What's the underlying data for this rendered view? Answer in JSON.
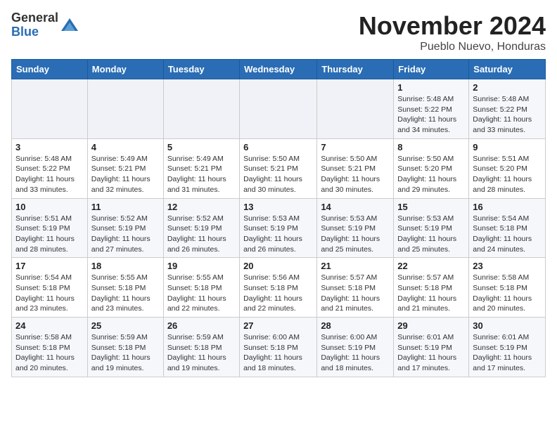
{
  "header": {
    "logo_line1": "General",
    "logo_line2": "Blue",
    "month_year": "November 2024",
    "location": "Pueblo Nuevo, Honduras"
  },
  "days_of_week": [
    "Sunday",
    "Monday",
    "Tuesday",
    "Wednesday",
    "Thursday",
    "Friday",
    "Saturday"
  ],
  "weeks": [
    [
      {
        "day": "",
        "info": ""
      },
      {
        "day": "",
        "info": ""
      },
      {
        "day": "",
        "info": ""
      },
      {
        "day": "",
        "info": ""
      },
      {
        "day": "",
        "info": ""
      },
      {
        "day": "1",
        "info": "Sunrise: 5:48 AM\nSunset: 5:22 PM\nDaylight: 11 hours and 34 minutes."
      },
      {
        "day": "2",
        "info": "Sunrise: 5:48 AM\nSunset: 5:22 PM\nDaylight: 11 hours and 33 minutes."
      }
    ],
    [
      {
        "day": "3",
        "info": "Sunrise: 5:48 AM\nSunset: 5:22 PM\nDaylight: 11 hours and 33 minutes."
      },
      {
        "day": "4",
        "info": "Sunrise: 5:49 AM\nSunset: 5:21 PM\nDaylight: 11 hours and 32 minutes."
      },
      {
        "day": "5",
        "info": "Sunrise: 5:49 AM\nSunset: 5:21 PM\nDaylight: 11 hours and 31 minutes."
      },
      {
        "day": "6",
        "info": "Sunrise: 5:50 AM\nSunset: 5:21 PM\nDaylight: 11 hours and 30 minutes."
      },
      {
        "day": "7",
        "info": "Sunrise: 5:50 AM\nSunset: 5:21 PM\nDaylight: 11 hours and 30 minutes."
      },
      {
        "day": "8",
        "info": "Sunrise: 5:50 AM\nSunset: 5:20 PM\nDaylight: 11 hours and 29 minutes."
      },
      {
        "day": "9",
        "info": "Sunrise: 5:51 AM\nSunset: 5:20 PM\nDaylight: 11 hours and 28 minutes."
      }
    ],
    [
      {
        "day": "10",
        "info": "Sunrise: 5:51 AM\nSunset: 5:19 PM\nDaylight: 11 hours and 28 minutes."
      },
      {
        "day": "11",
        "info": "Sunrise: 5:52 AM\nSunset: 5:19 PM\nDaylight: 11 hours and 27 minutes."
      },
      {
        "day": "12",
        "info": "Sunrise: 5:52 AM\nSunset: 5:19 PM\nDaylight: 11 hours and 26 minutes."
      },
      {
        "day": "13",
        "info": "Sunrise: 5:53 AM\nSunset: 5:19 PM\nDaylight: 11 hours and 26 minutes."
      },
      {
        "day": "14",
        "info": "Sunrise: 5:53 AM\nSunset: 5:19 PM\nDaylight: 11 hours and 25 minutes."
      },
      {
        "day": "15",
        "info": "Sunrise: 5:53 AM\nSunset: 5:19 PM\nDaylight: 11 hours and 25 minutes."
      },
      {
        "day": "16",
        "info": "Sunrise: 5:54 AM\nSunset: 5:18 PM\nDaylight: 11 hours and 24 minutes."
      }
    ],
    [
      {
        "day": "17",
        "info": "Sunrise: 5:54 AM\nSunset: 5:18 PM\nDaylight: 11 hours and 23 minutes."
      },
      {
        "day": "18",
        "info": "Sunrise: 5:55 AM\nSunset: 5:18 PM\nDaylight: 11 hours and 23 minutes."
      },
      {
        "day": "19",
        "info": "Sunrise: 5:55 AM\nSunset: 5:18 PM\nDaylight: 11 hours and 22 minutes."
      },
      {
        "day": "20",
        "info": "Sunrise: 5:56 AM\nSunset: 5:18 PM\nDaylight: 11 hours and 22 minutes."
      },
      {
        "day": "21",
        "info": "Sunrise: 5:57 AM\nSunset: 5:18 PM\nDaylight: 11 hours and 21 minutes."
      },
      {
        "day": "22",
        "info": "Sunrise: 5:57 AM\nSunset: 5:18 PM\nDaylight: 11 hours and 21 minutes."
      },
      {
        "day": "23",
        "info": "Sunrise: 5:58 AM\nSunset: 5:18 PM\nDaylight: 11 hours and 20 minutes."
      }
    ],
    [
      {
        "day": "24",
        "info": "Sunrise: 5:58 AM\nSunset: 5:18 PM\nDaylight: 11 hours and 20 minutes."
      },
      {
        "day": "25",
        "info": "Sunrise: 5:59 AM\nSunset: 5:18 PM\nDaylight: 11 hours and 19 minutes."
      },
      {
        "day": "26",
        "info": "Sunrise: 5:59 AM\nSunset: 5:18 PM\nDaylight: 11 hours and 19 minutes."
      },
      {
        "day": "27",
        "info": "Sunrise: 6:00 AM\nSunset: 5:18 PM\nDaylight: 11 hours and 18 minutes."
      },
      {
        "day": "28",
        "info": "Sunrise: 6:00 AM\nSunset: 5:19 PM\nDaylight: 11 hours and 18 minutes."
      },
      {
        "day": "29",
        "info": "Sunrise: 6:01 AM\nSunset: 5:19 PM\nDaylight: 11 hours and 17 minutes."
      },
      {
        "day": "30",
        "info": "Sunrise: 6:01 AM\nSunset: 5:19 PM\nDaylight: 11 hours and 17 minutes."
      }
    ]
  ]
}
